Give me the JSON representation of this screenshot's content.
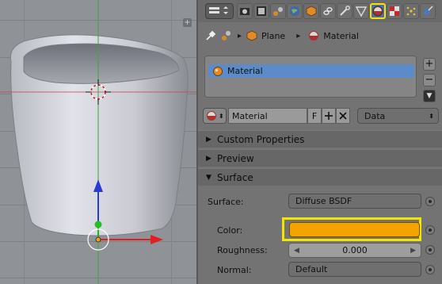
{
  "viewport": {
    "split_icon": "+",
    "icons": [
      "3d-cursor-icon",
      "z-axis-arrow-icon",
      "x-axis-arrow-icon",
      "y-axis-dot-icon",
      "object-origin-icon"
    ]
  },
  "properties": {
    "tabs": [
      "render-layers-icon",
      "scene-icon",
      "world-icon",
      "object-icon",
      "constraints-icon",
      "modifiers-icon",
      "data-icon",
      "material-icon",
      "texture-icon",
      "particles-icon",
      "physics-icon"
    ],
    "active_tab": "material-icon",
    "breadcrumb": {
      "object": "Plane",
      "material": "Material",
      "separator": "▸"
    },
    "slots": {
      "items": [
        "Material"
      ],
      "add_label": "+",
      "remove_label": "−",
      "menu_label": "▼"
    },
    "datablock": {
      "name": "Material",
      "fake_user": "F",
      "link": "Data"
    },
    "sections": {
      "custom_properties": "Custom Properties",
      "preview": "Preview",
      "surface": "Surface"
    },
    "surface": {
      "surface_label": "Surface:",
      "surface_value": "Diffuse BSDF",
      "color_label": "Color:",
      "color_value": "#F5A300",
      "roughness_label": "Roughness:",
      "roughness_value": "0.000",
      "normal_label": "Normal:",
      "normal_value": "Default"
    },
    "highlight_color": "#F2E600"
  }
}
